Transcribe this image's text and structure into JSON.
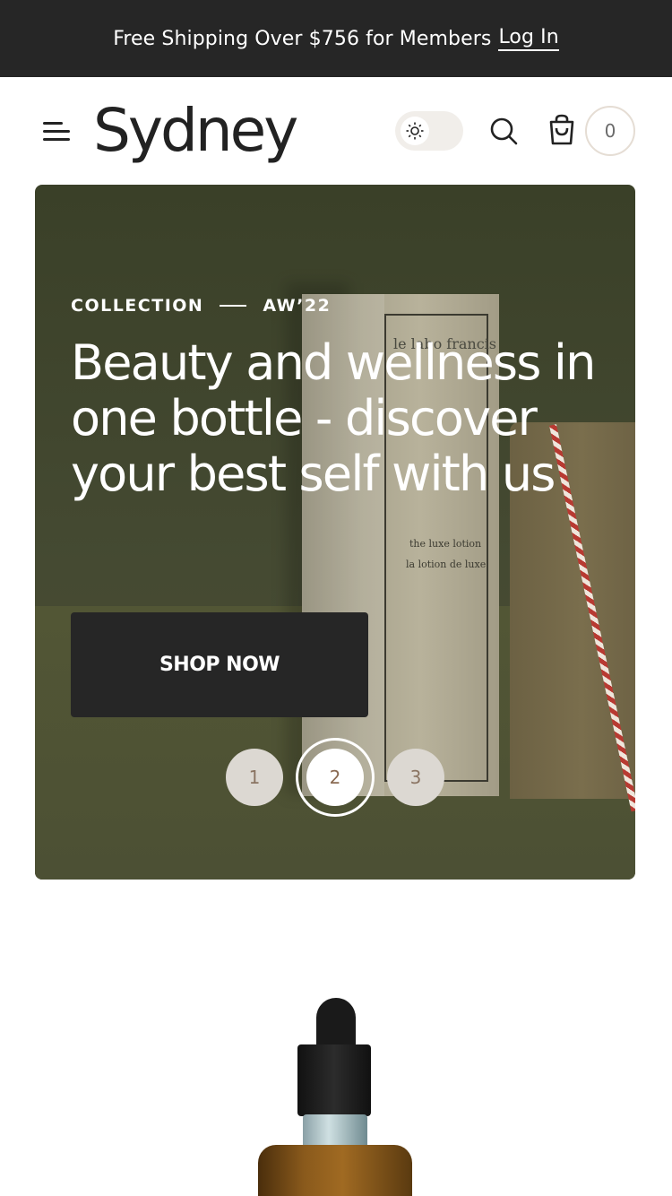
{
  "announcement": {
    "text": "Free Shipping Over $756 for Members",
    "login_link": "Log In"
  },
  "header": {
    "logo": "Sydney",
    "menu_icon": "hamburger-menu-icon",
    "theme_icon": "sun-icon",
    "search_icon": "search-icon",
    "cart_icon": "shopping-bag-icon",
    "cart_count": "0"
  },
  "hero": {
    "eyebrow_left": "COLLECTION",
    "eyebrow_right": "AW’22",
    "headline": "Beauty and wellness in one bottle - discover your best self with us",
    "cta_label": "SHOP NOW",
    "product_brand_text": "le labo francis",
    "product_line1": "the luxe lotion",
    "product_line2": "la lotion de luxe",
    "slides": [
      "1",
      "2",
      "3"
    ],
    "active_slide": "2"
  },
  "colors": {
    "announcement_bg": "#262626",
    "hero_bg": "#454a32",
    "button_bg": "#262626",
    "accent": "#8a6a52"
  }
}
